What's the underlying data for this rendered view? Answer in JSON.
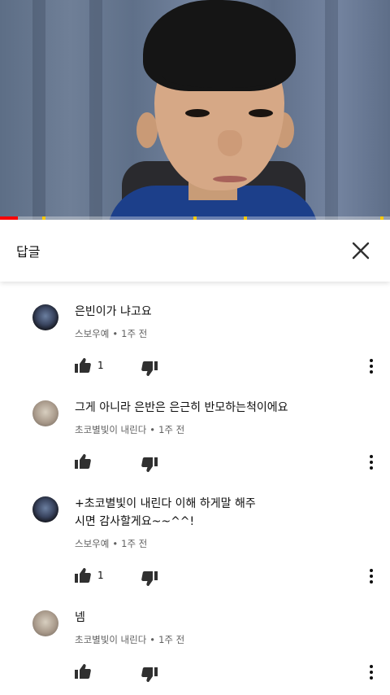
{
  "player": {
    "progress_fraction": 0.045,
    "colors": {
      "played": "#ff0000",
      "ad_marker": "#ffcc00"
    }
  },
  "header": {
    "title": "답글",
    "close_icon": "close-icon"
  },
  "comments": [
    {
      "avatar": "dark",
      "text": "은빈이가 냐고요",
      "author": "스보우예",
      "time": "1주 전",
      "likes": "1"
    },
    {
      "avatar": "light",
      "text": "그게 아니라  은반은 은근히 반모하는척이에요",
      "author": "초코별빛이 내린다",
      "time": "1주 전",
      "likes": ""
    },
    {
      "avatar": "dark",
      "text": "+초코별빛이 내린다 이해 하게말 해주\n시면 감사할게요~~^^!",
      "author": "스보우예",
      "time": "1주 전",
      "likes": "1"
    },
    {
      "avatar": "light",
      "text": "넴",
      "author": "초코별빛이 내린다",
      "time": "1주 전",
      "likes": ""
    }
  ],
  "icons": {
    "like": "thumbs-up-icon",
    "dislike": "thumbs-down-icon",
    "more": "more-vert-icon"
  }
}
